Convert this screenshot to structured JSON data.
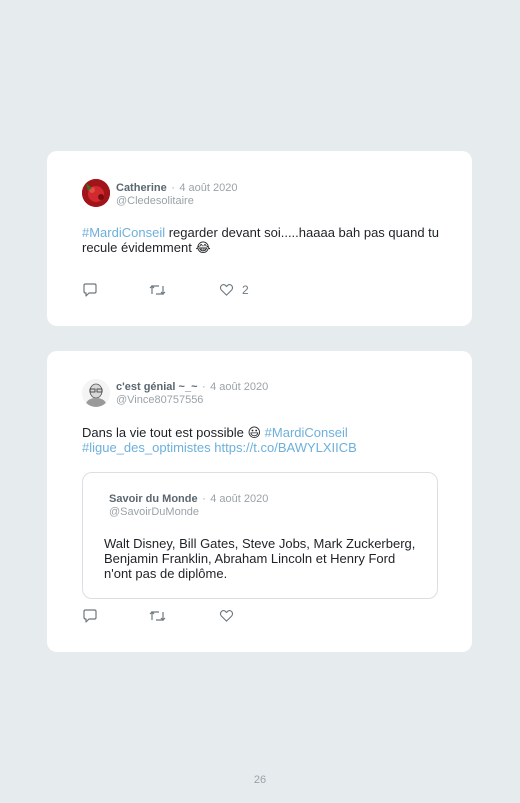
{
  "tweets": [
    {
      "author": "Catherine",
      "separator": "·",
      "date": "4 août 2020",
      "handle": "@Cledesolitaire",
      "hashtag": "#MardiConseil",
      "text": " regarder devant soi.....haaaa bah pas quand tu recule évidemment 😂",
      "like_count": "2"
    },
    {
      "author": "c'est génial ~_~",
      "separator": "·",
      "date": "4 août 2020",
      "handle": "@Vince80757556",
      "text": "Dans la vie tout est possible 😃 ",
      "hashtag": "#MardiConseil",
      "hashtag2": "#ligue_des_optimistes",
      "link": "https://t.co/BAWYLXIICB",
      "quoted": {
        "author": "Savoir du Monde",
        "separator": "·",
        "date": "4 août 2020",
        "handle": "@SavoirDuMonde",
        "text": "Walt Disney, Bill Gates, Steve Jobs, Mark Zuckerberg, Benjamin Franklin, Abraham Lincoln et Henry Ford n'ont pas de diplôme."
      }
    }
  ],
  "page_number": "26",
  "icons": [
    "reply-icon",
    "retweet-icon",
    "like-icon"
  ],
  "colors": {
    "background": "#e6ecee",
    "card": "#ffffff",
    "hashtag": "#6cb0dc",
    "meta": "#9aa3a9"
  }
}
